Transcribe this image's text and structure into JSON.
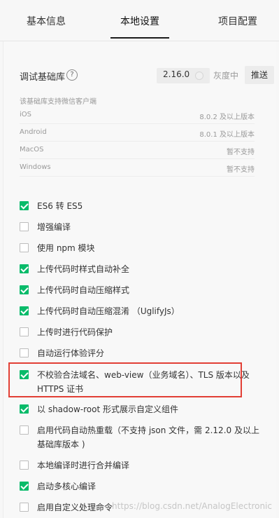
{
  "tabs": [
    {
      "label": "基本信息"
    },
    {
      "label": "本地设置"
    },
    {
      "label": "项目配置"
    }
  ],
  "debug_lib": {
    "label": "调试基础库",
    "version": "2.16.0",
    "gray_label": "灰度中",
    "push_label": "推送",
    "help_icon": "help-icon"
  },
  "support": {
    "caption": "该基础库支持微信客户端",
    "rows": [
      {
        "name": "iOS",
        "value": "8.0.2 及以上版本"
      },
      {
        "name": "Android",
        "value": "8.0.1 及以上版本"
      },
      {
        "name": "MacOS",
        "value": "暂不支持"
      },
      {
        "name": "Windows",
        "value": "暂不支持"
      }
    ]
  },
  "options": [
    {
      "label": "ES6 转 ES5",
      "checked": true
    },
    {
      "label": "增强编译",
      "checked": false
    },
    {
      "label": "使用 npm 模块",
      "checked": false
    },
    {
      "label": "上传代码时样式自动补全",
      "checked": true
    },
    {
      "label": "上传代码时自动压缩样式",
      "checked": true
    },
    {
      "label": "上传代码时自动压缩混淆 （UglifyJs）",
      "checked": true
    },
    {
      "label": "上传时进行代码保护",
      "checked": false
    },
    {
      "label": "自动运行体验评分",
      "checked": false
    },
    {
      "label": "不校验合法域名、web-view（业务域名）、TLS 版本以及 HTTPS 证书",
      "checked": true
    },
    {
      "label": "以 shadow-root 形式展示自定义组件",
      "checked": true
    },
    {
      "label": "启用代码自动热重载（不支持 json 文件，需 2.12.0 及以上基础库版本 )",
      "checked": false
    },
    {
      "label": "本地编译时进行合并编译",
      "checked": false
    },
    {
      "label": "启动多核心编译",
      "checked": true
    },
    {
      "label": "启用自定义处理命令",
      "checked": false
    }
  ],
  "watermark": "https://blog.csdn.net/AnalogElectronic",
  "colors": {
    "check_green": "#09bb6a",
    "highlight_red": "#e23f35"
  }
}
